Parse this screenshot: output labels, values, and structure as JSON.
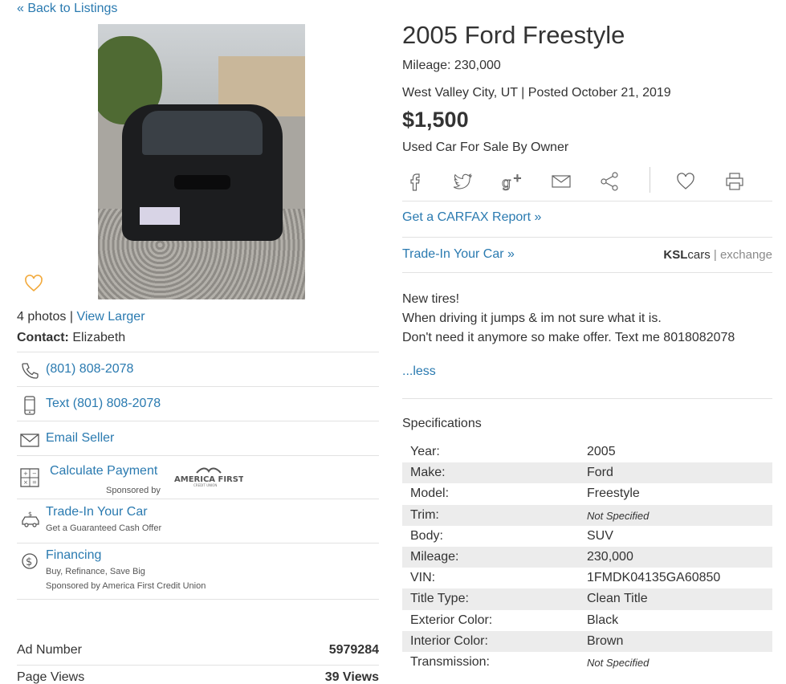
{
  "nav": {
    "back_label": "« Back to Listings"
  },
  "photo": {
    "count_text": "4 photos |",
    "view_larger": "View Larger"
  },
  "contact": {
    "label": "Contact:",
    "name": "Elizabeth"
  },
  "actions": {
    "phone": "(801) 808-2078",
    "text": "Text (801) 808-2078",
    "email": "Email Seller",
    "calculate": "Calculate Payment",
    "sponsored_by": "Sponsored by",
    "sponsor_logo": "AMERICA FIRST",
    "sponsor_logo_sub": "CREDIT UNION",
    "tradein": "Trade-In Your Car",
    "tradein_sub": "Get a Guaranteed Cash Offer",
    "financing": "Financing",
    "financing_sub1": "Buy, Refinance, Save Big",
    "financing_sub2": "Sponsored by America First Credit Union"
  },
  "stats": {
    "ad_label": "Ad Number",
    "ad_value": "5979284",
    "views_label": "Page Views",
    "views_value": "39 Views"
  },
  "listing": {
    "title": "2005 Ford Freestyle",
    "mileage": "Mileage: 230,000",
    "location": "West Valley City, UT | Posted October 21, 2019",
    "price": "$1,500",
    "type": "Used Car For Sale By Owner"
  },
  "links": {
    "carfax": "Get a CARFAX Report »",
    "tradein": "Trade-In Your Car »",
    "exchange_logo_bold": "KSL",
    "exchange_logo_cars": "cars",
    "exchange_logo_rest": "| exchange"
  },
  "description": {
    "line1": "New tires!",
    "line2": "When driving it jumps & im not sure what it is.",
    "line3": "Don't need it anymore so make offer. Text me 8018082078",
    "less": "...less"
  },
  "specs": {
    "heading": "Specifications",
    "rows": [
      {
        "key": "Year:",
        "value": "2005"
      },
      {
        "key": "Make:",
        "value": "Ford"
      },
      {
        "key": "Model:",
        "value": "Freestyle"
      },
      {
        "key": "Trim:",
        "value": "Not Specified"
      },
      {
        "key": "Body:",
        "value": "SUV"
      },
      {
        "key": "Mileage:",
        "value": "230,000"
      },
      {
        "key": "VIN:",
        "value": "1FMDK04135GA60850"
      },
      {
        "key": "Title Type:",
        "value": "Clean Title"
      },
      {
        "key": "Exterior Color:",
        "value": "Black"
      },
      {
        "key": "Interior Color:",
        "value": "Brown"
      },
      {
        "key": "Transmission:",
        "value": "Not Specified"
      }
    ]
  },
  "colors": {
    "link": "#2a7ab0",
    "alt_row": "#ececec",
    "heart": "#f2a93b"
  }
}
